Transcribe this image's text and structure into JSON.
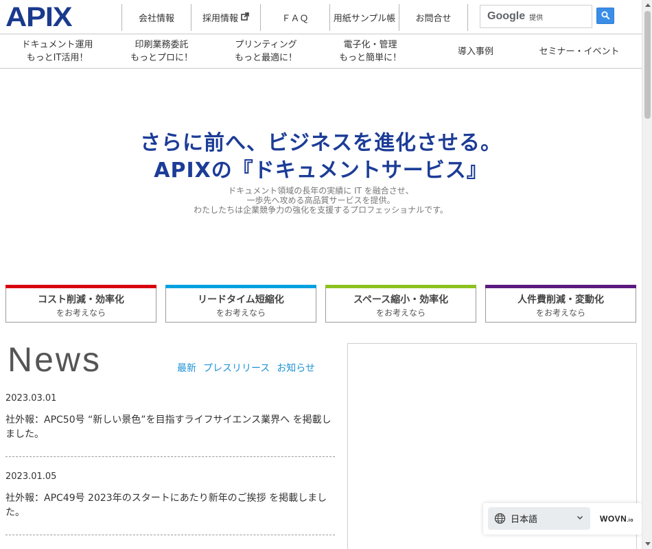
{
  "header": {
    "logo_text": "APIX",
    "topnav": [
      {
        "label": "会社情報",
        "external": false
      },
      {
        "label": "採用情報",
        "external": true
      },
      {
        "label": "ＦＡＱ",
        "external": false
      },
      {
        "label": "用紙サンプル帳",
        "external": false
      },
      {
        "label": "お問合せ",
        "external": false
      }
    ],
    "search": {
      "brand": "Google",
      "provided": "提供"
    }
  },
  "subnav": [
    {
      "line1": "ドキュメント運用",
      "line2": "もっとIT活用！"
    },
    {
      "line1": "印刷業務委託",
      "line2": "もっとプロに！"
    },
    {
      "line1": "プリンティング",
      "line2": "もっと最適に！"
    },
    {
      "line1": "電子化・管理",
      "line2": "もっと簡単に！"
    },
    {
      "line1": "導入事例",
      "line2": ""
    },
    {
      "line1": "セミナー・イベント",
      "line2": ""
    }
  ],
  "hero": {
    "title1": "さらに前へ、ビジネスを進化させる。",
    "title2": "APIXの『ドキュメントサービス』",
    "sub1": "ドキュメント領域の長年の実績に IT を融合させ、",
    "sub2": "一歩先へ攻める高品質サービスを提供。",
    "sub3": "わたしたちは企業競争力の強化を支援するプロフェッショナルです。"
  },
  "categories": [
    {
      "title": "コスト削減・効率化",
      "sub": "をお考えなら",
      "color": "#d7000f"
    },
    {
      "title": "リードタイム短縮化",
      "sub": "をお考えなら",
      "color": "#00a0e0"
    },
    {
      "title": "スペース縮小・効率化",
      "sub": "をお考えなら",
      "color": "#8cc220"
    },
    {
      "title": "人件費削減・変動化",
      "sub": "をお考えなら",
      "color": "#5a1a80"
    }
  ],
  "news": {
    "heading": "News",
    "tabs": [
      "最新",
      "プレスリリース",
      "お知らせ"
    ],
    "items": [
      {
        "date": "2023.03.01",
        "text": "社外報：APC50号 “新しい景色”を目指すライフサイエンス業界へ を掲載しました。"
      },
      {
        "date": "2023.01.05",
        "text": "社外報：APC49号 2023年のスタートにあたり新年のご挨拶 を掲載しました。"
      }
    ]
  },
  "language": {
    "selected": "日本語",
    "brand": "WOVN",
    "brand_suffix": ".io"
  }
}
